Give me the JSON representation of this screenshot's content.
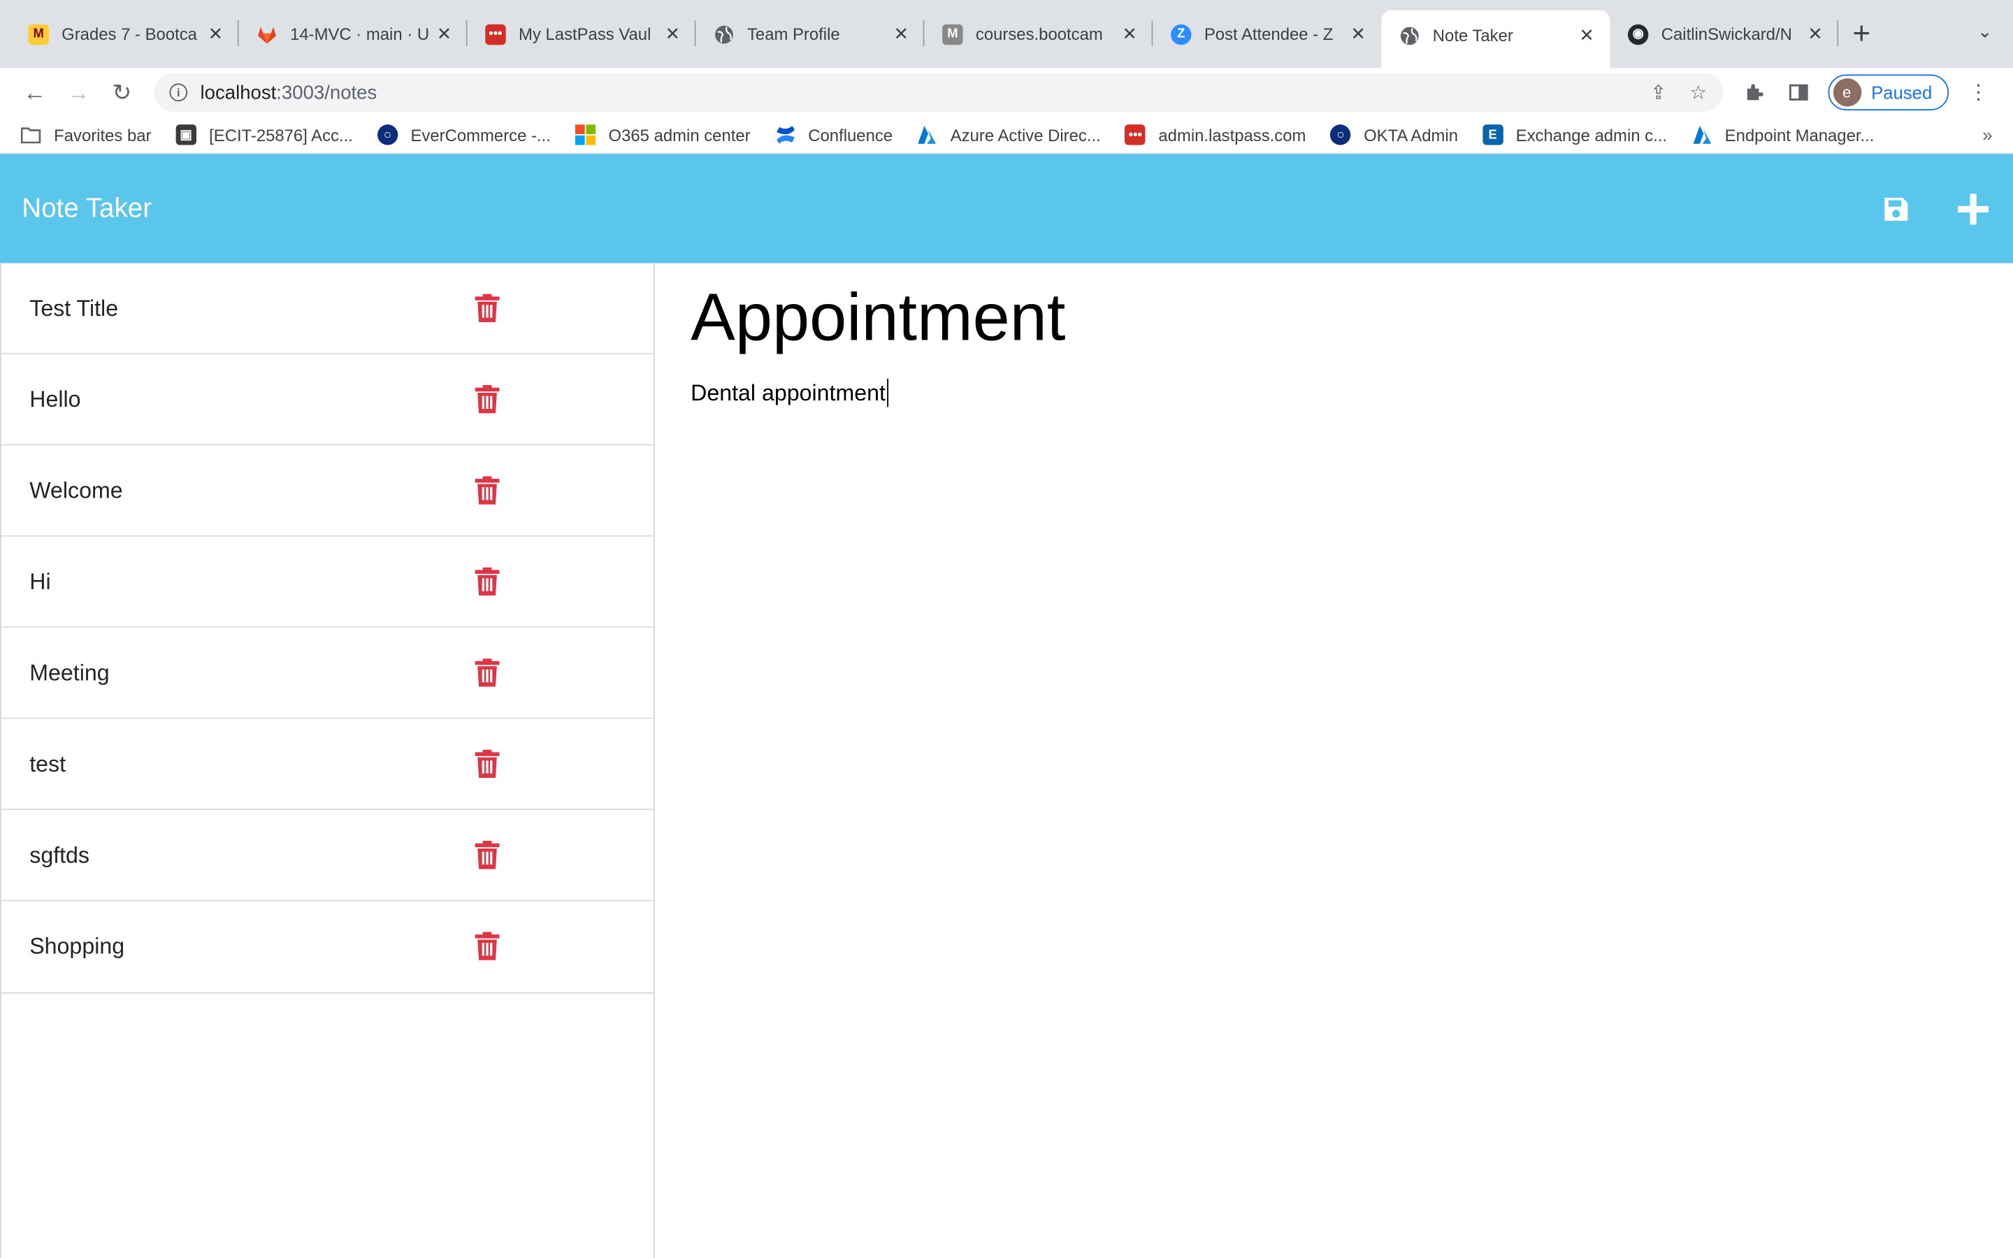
{
  "browser": {
    "tabs": [
      {
        "title": "Grades 7 - Bootca",
        "icon": "umn-icon",
        "color": "#7a0019"
      },
      {
        "title": "14-MVC · main · U",
        "icon": "gitlab-icon",
        "color": "#e24329"
      },
      {
        "title": "My LastPass Vaul",
        "icon": "lastpass-icon",
        "color": "#d32d27"
      },
      {
        "title": "Team Profile",
        "icon": "globe-icon",
        "color": "#5f6368"
      },
      {
        "title": "courses.bootcam",
        "icon": "bootcamp-icon",
        "color": "#777777"
      },
      {
        "title": "Post Attendee - Z",
        "icon": "zoom-icon",
        "color": "#2d8cff"
      },
      {
        "title": "Note Taker",
        "icon": "globe-icon",
        "color": "#5f6368",
        "active": true
      },
      {
        "title": "CaitlinSwickard/N",
        "icon": "github-icon",
        "color": "#24292f"
      }
    ],
    "url_host": "localhost",
    "url_path": ":3003/notes",
    "profile_initial": "e",
    "profile_status": "Paused",
    "bookmarks": [
      {
        "label": "Favorites bar",
        "icon": "folder-icon"
      },
      {
        "label": "[ECIT-25876] Acc...",
        "icon": "jira-icon"
      },
      {
        "label": "EverCommerce -...",
        "icon": "okta-icon"
      },
      {
        "label": "O365 admin center",
        "icon": "microsoft-icon"
      },
      {
        "label": "Confluence",
        "icon": "confluence-icon"
      },
      {
        "label": "Azure Active Direc...",
        "icon": "azure-icon"
      },
      {
        "label": "admin.lastpass.com",
        "icon": "lastpass-icon"
      },
      {
        "label": "OKTA Admin",
        "icon": "okta-icon"
      },
      {
        "label": "Exchange admin c...",
        "icon": "exchange-icon"
      },
      {
        "label": "Endpoint Manager...",
        "icon": "azure-icon"
      }
    ]
  },
  "app": {
    "title": "Note Taker",
    "accent_color": "#5bc6ec",
    "delete_color": "#dc3545",
    "notes": [
      {
        "title": "Test Title"
      },
      {
        "title": "Hello"
      },
      {
        "title": "Welcome"
      },
      {
        "title": "Hi"
      },
      {
        "title": "Meeting"
      },
      {
        "title": "test"
      },
      {
        "title": "sgftds"
      },
      {
        "title": "Shopping"
      }
    ],
    "active_note": {
      "title": "Appointment",
      "text": "Dental appointment"
    }
  }
}
